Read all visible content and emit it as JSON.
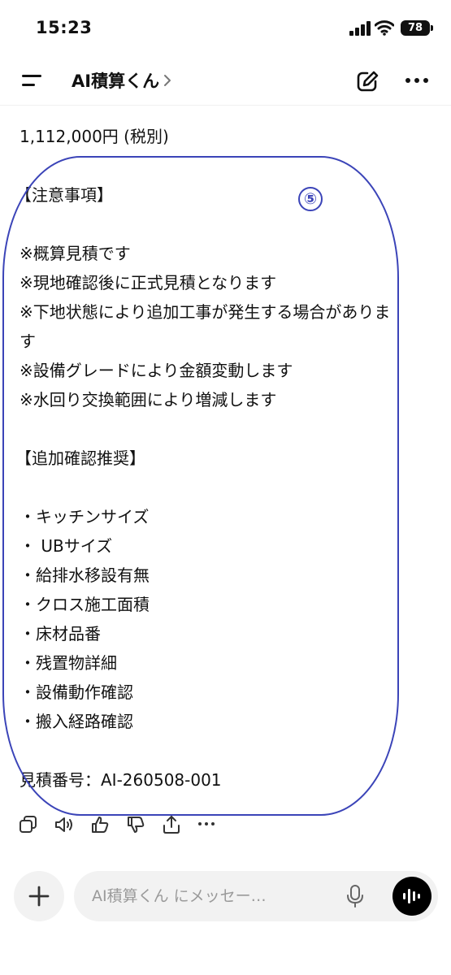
{
  "status_bar": {
    "time": "15:23",
    "battery": "78",
    "icons": [
      "signal-icon",
      "wifi-icon",
      "battery-icon"
    ]
  },
  "header": {
    "title": "AI積算くん",
    "icons": [
      "menu-icon",
      "chevron-right-icon",
      "compose-icon",
      "more-icon"
    ]
  },
  "message": {
    "lines": [
      "1,112,000円 (税別)",
      "",
      "【注意事項】",
      "",
      "※概算見積です",
      "※現地確認後に正式見積となります",
      "※下地状態により追加工事が発生する場合があります",
      "※設備グレードにより金額変動します",
      "※水回り交換範囲により増減します",
      "",
      "【追加確認推奨】",
      "",
      "・キッチンサイズ",
      "・ UBサイズ",
      "・給排水移設有無",
      "・クロス施工面積",
      "・床材品番",
      "・残置物詳細",
      "・設備動作確認",
      "・搬入経路確認",
      "",
      "見積番号：AI-260508-001"
    ]
  },
  "annotation": {
    "number": "⑤",
    "color": "#3b44b8"
  },
  "actions": {
    "icons": [
      "copy-icon",
      "speaker-icon",
      "thumbs-up-icon",
      "thumbs-down-icon",
      "share-icon",
      "more-icon"
    ]
  },
  "composer": {
    "placeholder": "AI積算くん にメッセー…",
    "icons": [
      "plus-icon",
      "microphone-icon",
      "voice-mode-icon"
    ]
  }
}
